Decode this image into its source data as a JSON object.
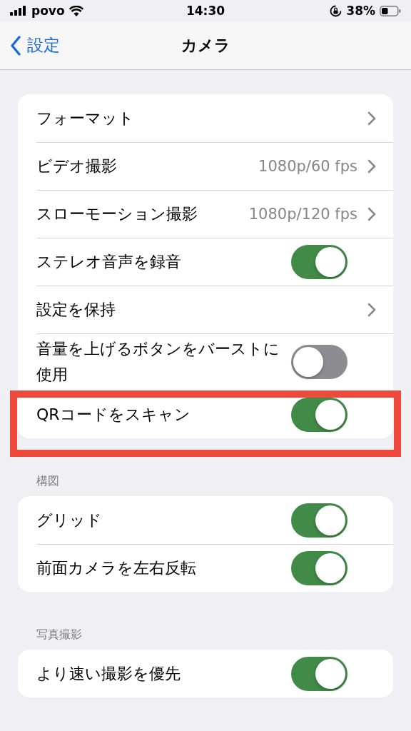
{
  "status_bar": {
    "carrier": "povo",
    "time": "14:30",
    "battery": "38%"
  },
  "nav": {
    "back": "設定",
    "title": "カメラ"
  },
  "sections": [
    {
      "rows": [
        {
          "kind": "link",
          "label": "フォーマット",
          "highlighted": false
        },
        {
          "kind": "link",
          "label": "ビデオ撮影",
          "value": "1080p/60 fps",
          "highlighted": false
        },
        {
          "kind": "link",
          "label": "スローモーション撮影",
          "value": "1080p/120 fps",
          "highlighted": false
        },
        {
          "kind": "toggle",
          "label": "ステレオ音声を録音",
          "on": true,
          "highlighted": false
        },
        {
          "kind": "link",
          "label": "設定を保持",
          "highlighted": false
        },
        {
          "kind": "toggle",
          "label": "音量を上げるボタンをバーストに使用",
          "on": false,
          "highlighted": false
        },
        {
          "kind": "toggle",
          "label": "QRコードをスキャン",
          "on": true,
          "highlighted": true
        }
      ]
    },
    {
      "header": "構図",
      "rows": [
        {
          "kind": "toggle",
          "label": "グリッド",
          "on": true,
          "highlighted": false
        },
        {
          "kind": "toggle",
          "label": "前面カメラを左右反転",
          "on": true,
          "highlighted": false
        }
      ]
    },
    {
      "header": "写真撮影",
      "rows": [
        {
          "kind": "toggle",
          "label": "より速い撮影を優先",
          "on": true,
          "highlighted": false
        }
      ]
    }
  ]
}
